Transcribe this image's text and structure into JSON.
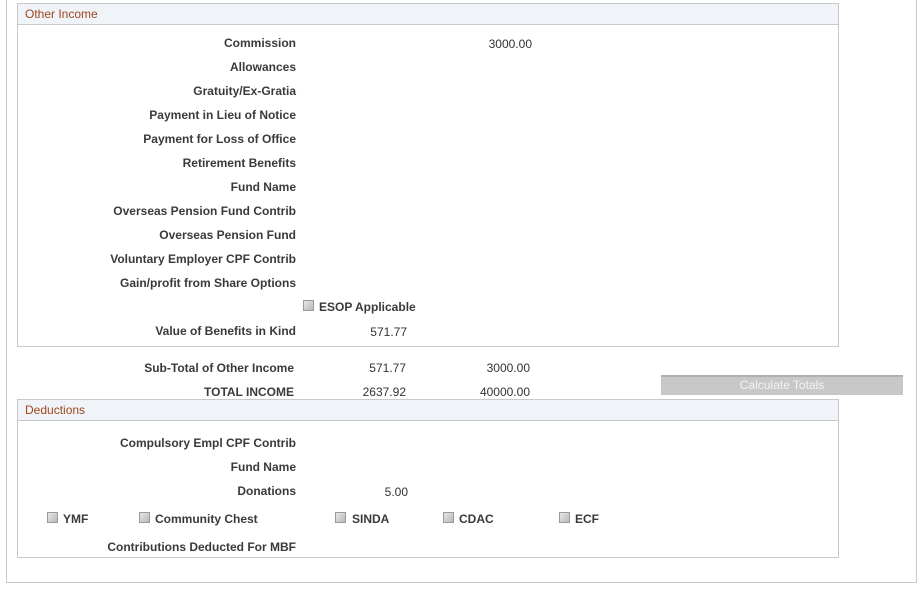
{
  "other_income": {
    "title": "Other Income",
    "rows": [
      {
        "label": "Commission",
        "value1": "",
        "value2": "3000.00"
      },
      {
        "label": "Allowances",
        "value1": "",
        "value2": ""
      },
      {
        "label": "Gratuity/Ex-Gratia",
        "value1": "",
        "value2": ""
      },
      {
        "label": "Payment in Lieu of Notice",
        "value1": "",
        "value2": ""
      },
      {
        "label": "Payment for Loss of Office",
        "value1": "",
        "value2": ""
      },
      {
        "label": "Retirement Benefits",
        "value1": "",
        "value2": ""
      },
      {
        "label": "Fund Name",
        "value1": "",
        "value2": ""
      },
      {
        "label": "Overseas Pension Fund Contrib",
        "value1": "",
        "value2": ""
      },
      {
        "label": "Overseas Pension Fund",
        "value1": "",
        "value2": ""
      },
      {
        "label": "Voluntary Employer CPF Contrib",
        "value1": "",
        "value2": ""
      },
      {
        "label": "Gain/profit from Share Options",
        "value1": "",
        "value2": ""
      }
    ],
    "esop_label": "ESOP Applicable",
    "benefits_label": "Value of Benefits in Kind",
    "benefits_value": "571.77"
  },
  "totals": {
    "subtotal_label": "Sub-Total of Other Income",
    "subtotal_value1": "571.77",
    "subtotal_value2": "3000.00",
    "total_label": "TOTAL INCOME",
    "total_value1": "2637.92",
    "total_value2": "40000.00",
    "calculate_button": "Calculate Totals"
  },
  "deductions": {
    "title": "Deductions",
    "cpf_label": "Compulsory Empl CPF Contrib",
    "fund_label": "Fund Name",
    "donations_label": "Donations",
    "donations_value": "5.00",
    "checkboxes": [
      "YMF",
      "Community Chest",
      "SINDA",
      "CDAC",
      "ECF"
    ],
    "mbf_label": "Contributions Deducted For MBF"
  }
}
